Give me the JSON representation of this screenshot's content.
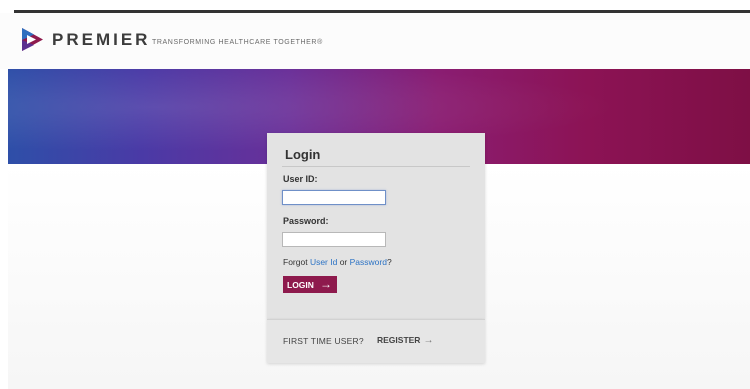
{
  "header": {
    "brand": "PREMIER",
    "tagline": "TRANSFORMING HEALTHCARE TOGETHER",
    "tagline_mark": "®",
    "logo_icon": "premier-logo-icon"
  },
  "colors": {
    "brand_purple": "#8e1a4d",
    "banner_blue": "#2e4fa8",
    "banner_magenta": "#7e0f45",
    "link_blue": "#2c73c5"
  },
  "login": {
    "title": "Login",
    "user_id_label": "User ID:",
    "user_id_value": "",
    "password_label": "Password:",
    "password_value": "",
    "forgot_prefix": "Forgot ",
    "forgot_user_id": "User Id",
    "forgot_or": " or ",
    "forgot_password": "Password",
    "forgot_suffix": "?",
    "button_label": "LOGIN",
    "button_arrow": "→"
  },
  "register": {
    "prompt": "FIRST TIME USER?",
    "link_label": "REGISTER",
    "link_arrow": "→"
  }
}
